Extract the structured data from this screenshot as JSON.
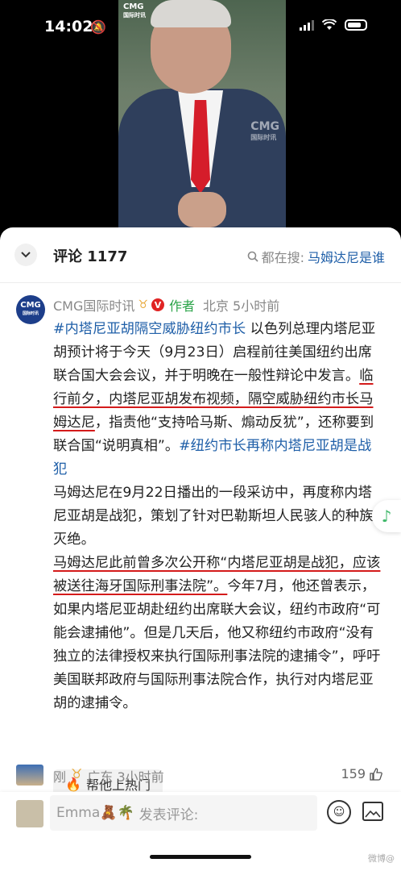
{
  "status_bar": {
    "time": "14:02"
  },
  "video": {
    "badge_main": "CMG",
    "badge_sub": "国际时讯",
    "water_main": "CMG",
    "water_sub": "国际时讯"
  },
  "header": {
    "comment_label": "评论 1177",
    "search_prefix": "都在搜:",
    "search_keyword": "马姆达尼是谁"
  },
  "post": {
    "avatar_main": "CMG",
    "avatar_sub": "国际时讯",
    "author_name": "CMG国际时讯",
    "author_tag": "作者",
    "location_time": "北京 5小时前",
    "para1_tag1": "#内塔尼亚胡隔空威胁纽约市长",
    "para1_text1": " 以色列总理内塔尼亚胡预计将于今天（9月23日）启程前往美国纽约出席联合国大会会议，并于明晚在一般性辩论中发言。",
    "para1_underlined": "临行前夕，内塔尼亚胡发布视频，隔空威胁纽约市长马姆达尼",
    "para1_text2": "，指责他“支持哈马斯、煽动反犹”，还称要到联合国“说明真相”。",
    "para1_tag2": "#纽约市长再称内塔尼亚胡是战犯",
    "para2": "马姆达尼在9月22日播出的一段采访中，再度称内塔尼亚胡是战犯，策划了针对巴勒斯坦人民骇人的种族灭绝。",
    "para3_underlined": "马姆达尼此前曾多次公开称“内塔尼亚胡是战犯，应该被送往海牙国际刑事法院”。",
    "para3_text": "今年7月，他还曾表示，如果内塔尼亚胡赴纽约出席联大会议，纽约市政府“可能会逮捕他”。但是几天后，他又称纽约市政府“没有独立的法律授权来执行国际刑事法院的逮捕令”，呼吁美国联邦政府与国际刑事法院合作，执行对内塔尼亚胡的逮捕令。",
    "hot_button": "帮他上热门"
  },
  "reply": {
    "name": "刚",
    "location_time": "广东 3小时前",
    "likes": "159"
  },
  "input": {
    "user": "Emma🧸🌴",
    "placeholder": "发表评论:"
  },
  "watermark": "微博@"
}
